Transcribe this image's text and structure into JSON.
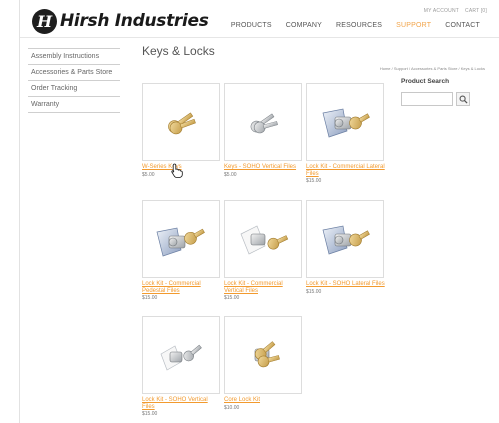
{
  "header": {
    "logo_letter": "H",
    "logo_text": "Hirsh Industries",
    "util_links": [
      "MY ACCOUNT",
      "CART [0]"
    ],
    "nav": [
      {
        "label": "PRODUCTS",
        "active": false
      },
      {
        "label": "COMPANY",
        "active": false
      },
      {
        "label": "RESOURCES",
        "active": false
      },
      {
        "label": "SUPPORT",
        "active": true
      },
      {
        "label": "CONTACT",
        "active": false
      }
    ],
    "accent_color": "#f2a44a"
  },
  "sidebar": {
    "items": [
      {
        "label": "Assembly Instructions"
      },
      {
        "label": "Accessories & Parts Store"
      },
      {
        "label": "Order Tracking"
      },
      {
        "label": "Warranty"
      }
    ]
  },
  "page": {
    "title": "Keys & Locks",
    "breadcrumb": "Home / Support / Accessories & Parts Store / Keys & Locks"
  },
  "search": {
    "label": "Product Search",
    "value": "",
    "button_icon": "magnifier-icon"
  },
  "products": [
    {
      "name": "W-Series Keys",
      "price": "$5.00",
      "image": "key-pair"
    },
    {
      "name": "Keys - SOHO Vertical Files",
      "price": "$5.00",
      "image": "key-pair-silver"
    },
    {
      "name": "Lock Kit - Commercial Lateral Files",
      "price": "$15.00",
      "image": "lock-kit"
    },
    {
      "name": "Lock Kit - Commercial Pedestal Files",
      "price": "$15.00",
      "image": "lock-kit"
    },
    {
      "name": "Lock Kit - Commercial Vertical Files",
      "price": "$15.00",
      "image": "lock-kit-white"
    },
    {
      "name": "Lock Kit - SOHO Lateral Files",
      "price": "$15.00",
      "image": "lock-kit"
    },
    {
      "name": "Lock Kit - SOHO Vertical Files",
      "price": "$15.00",
      "image": "lock-kit-white"
    },
    {
      "name": "Core Lock Kit",
      "price": "$10.00",
      "image": "core-lock"
    }
  ]
}
